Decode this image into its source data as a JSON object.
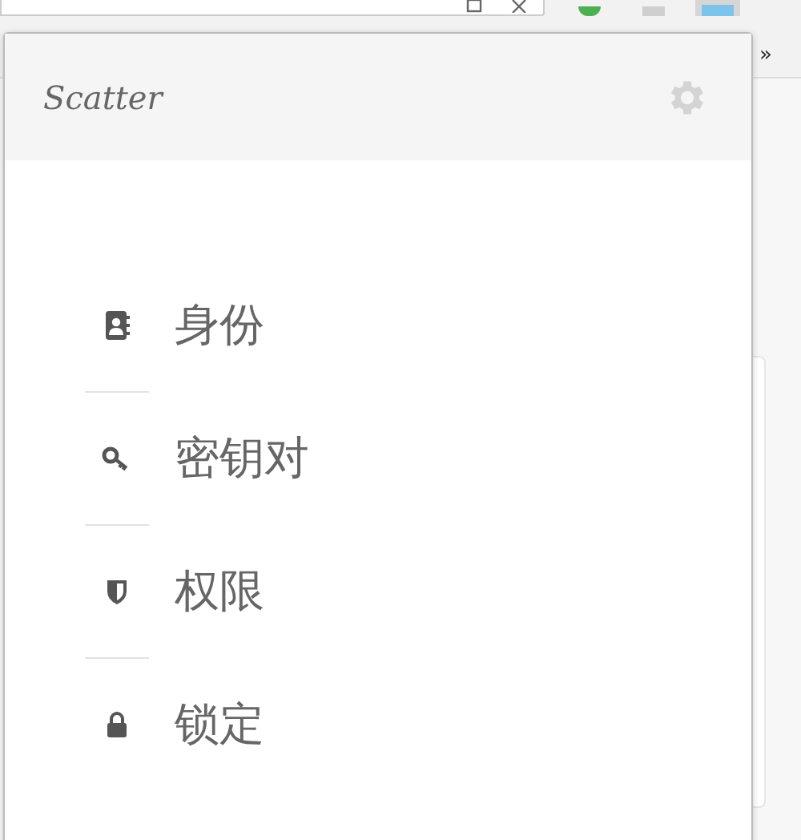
{
  "toolbar": {
    "overflow": "»",
    "extensions": [
      {
        "kind": "green",
        "selected": false
      },
      {
        "kind": "gray",
        "selected": false
      },
      {
        "kind": "blue",
        "selected": true
      }
    ]
  },
  "popup": {
    "logo": "Scatter",
    "menu": [
      {
        "label": "身份",
        "kind": "identity"
      },
      {
        "label": "密钥对",
        "kind": "keypair"
      },
      {
        "label": "权限",
        "kind": "permission"
      },
      {
        "label": "锁定",
        "kind": "lock"
      }
    ]
  }
}
